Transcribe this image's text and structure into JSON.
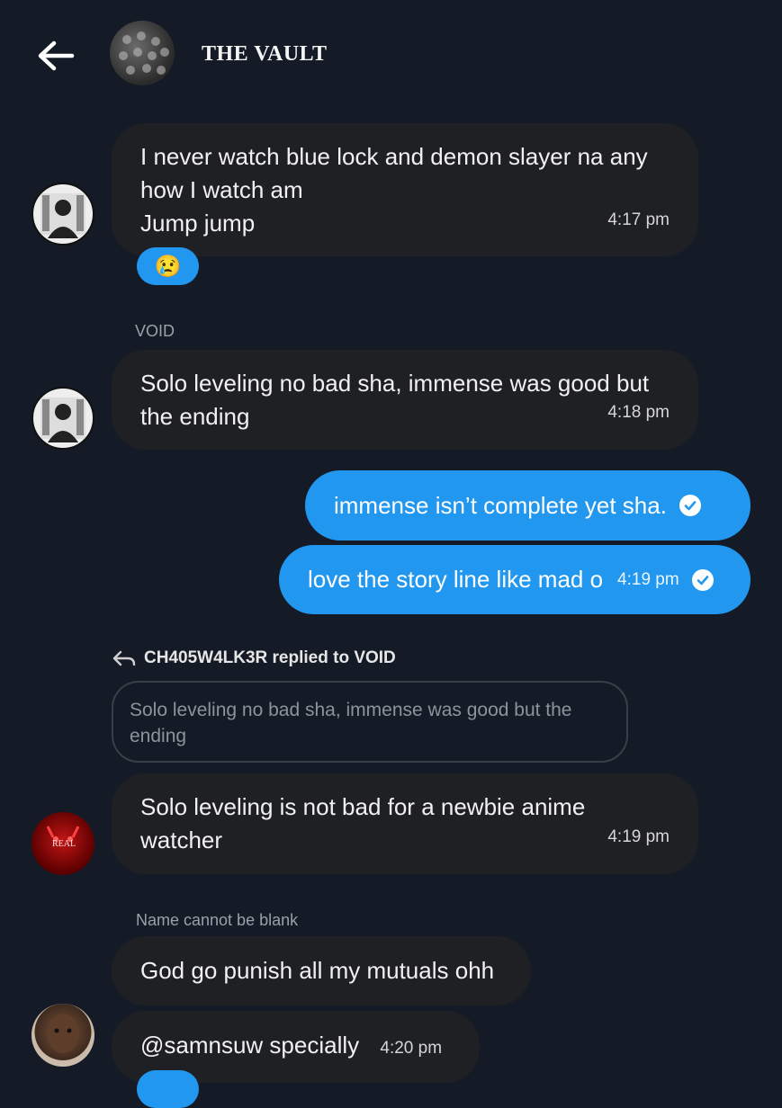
{
  "header": {
    "title": "THE VAULT",
    "back_icon": "arrow-left-icon",
    "avatar_icon": "group-avatar"
  },
  "messages": [
    {
      "lines": [
        "I never watch blue lock and demon slayer na any",
        "how I watch am",
        "Jump jump"
      ],
      "time": "4:17 pm",
      "reaction": "😢"
    },
    {
      "sender": "VOID",
      "lines": [
        "Solo leveling no bad sha, immense was good but",
        "the ending"
      ],
      "time": "4:18 pm"
    },
    {
      "outgoing": true,
      "text": "immense isn’t complete yet sha.",
      "read_icon": "check-circle-icon"
    },
    {
      "outgoing": true,
      "text": "love the story line like mad o",
      "time": "4:19 pm",
      "read_icon": "check-circle-icon"
    },
    {
      "reply_label": "CH405W4LK3R replied to VOID",
      "quoted": "Solo leveling no bad sha, immense was good but the ending",
      "lines": [
        "Solo leveling is not bad for a newbie anime",
        "watcher"
      ],
      "time": "4:19 pm",
      "avatar_text": "REAL"
    },
    {
      "sender": "Name cannot be blank",
      "text": "God go punish all my mutuals ohh"
    },
    {
      "text": "@samnsuw specially",
      "time": "4:20 pm"
    }
  ],
  "colors": {
    "background": "#141b26",
    "incoming_bubble": "#1f2023",
    "outgoing_bubble": "#2197f0"
  }
}
